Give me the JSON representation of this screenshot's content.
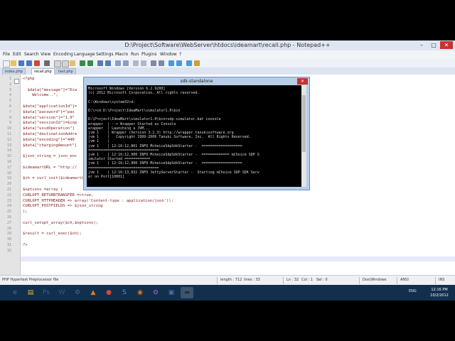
{
  "window": {
    "title": "D:\\Project\\Software\\WebServer\\htdocs\\ideamart\\recall.php - Notepad++",
    "controls": [
      "–",
      "□",
      "✕"
    ]
  },
  "menu": [
    "File",
    "Edit",
    "Search",
    "View",
    "Encoding",
    "Language",
    "Settings",
    "Macro",
    "Run",
    "Plugins",
    "Window",
    "?"
  ],
  "tabs": [
    "index.php",
    "recall.php",
    "test.php"
  ],
  "editor": {
    "line_numbers": [
      "1",
      "2",
      "3",
      "4",
      "5",
      "6",
      "7",
      "8",
      "9",
      "10",
      "11",
      "12",
      "13",
      "14",
      "15",
      "16",
      "17",
      "18",
      "19",
      "20",
      "21",
      "22",
      "23",
      "24",
      "25",
      "26",
      "27",
      "28",
      "29",
      "30",
      "31",
      "32"
    ],
    "lines": [
      "<?php",
      "",
      "  $data[\"message\"]=\"Dia",
      "    Welcome..\";",
      "",
      "$data[\"applicationId\"]=",
      "$data[\"password\"]=\"pas",
      "$data[\"version\"]=\"1.0\"",
      "$data[\"sessionId\"]=$inp",
      "$data[\"ussdOperation\"]",
      "$data[\"destinationAddre",
      "$data[\"encoding\"]=\"440",
      "$data[\"chargingAmount\"]",
      "",
      "$json_string = json_enc",
      "",
      "$ideamartURL = \"http://",
      "",
      "$ch = curl_init($ideamartURL);",
      "",
      "$options =array (",
      "CURLOPT_RETURNTRANSFER =>true,",
      "CURLOPT_HTTPHEADER => array('Content-type : application/json'));",
      "CURLOPT_POSTFIELDS => $json_string",
      ");",
      "",
      "curl_setopt_array($ch,$options);",
      "",
      "$result = curl_exec($ch);",
      "",
      "?>",
      ""
    ]
  },
  "status": {
    "filetype": "PHP Hypertext Preprocessor file",
    "length": "length : 712",
    "lines": "lines : 33",
    "position": "Ln : 32",
    "col": "Col : 1",
    "sel": "Sel : 0",
    "eol": "Dos\\Windows",
    "encoding": "ANSI",
    "mode": "INS"
  },
  "console": {
    "title": "sdk-standalone",
    "close": "✕",
    "lines": [
      "Microsoft Windows [Version 6.2.9200]",
      "(c) 2012 Microsoft Corporation. All rights reserved.",
      "",
      "C:\\Windows\\system32>d:",
      "",
      "D:\\>cd D:\\Project\\IdeaMart\\simulator1.0\\bin",
      "",
      "D:\\Project\\IdeaMart\\simulator1.0\\bin>sdp-simulator.bat console",
      "wrapper  | --> Wrapper Started as Console",
      "wrapper  | Launching a JVM...",
      "jvm 1    | Wrapper (Version 3.2.3) http://wrapper.tanukisoftware.org",
      "jvm 1    |   Copyright 1999-2006 Tanuki Software, Inc.  All Rights Reserved.",
      "jvm 1    |",
      "jvm 1    | 12:16:12,861 INFO McheiceSdpSdkStarter -  ===================",
      "=================================",
      "jvm 1    | 12:16:12,900 INFO McheiceSdpSdkStarter -  ============= mChoice SDP S",
      "imulator Started ============",
      "jvm 1    | 12:16:12,900 INFO McheiceSdpSdkStarter -  ===================",
      "=================================",
      "jvm 1    | 12:16:13,832 INFO JettyServerStarter -  Starting mChoice SDP SDK Serv",
      "er on Port[10001]"
    ]
  },
  "taskbar": {
    "icons": [
      {
        "name": "ie-icon",
        "glyph": "e",
        "color": "#2a7fd4"
      },
      {
        "name": "explorer-icon",
        "glyph": "▤",
        "color": "#e6b63a"
      },
      {
        "name": "ps-icon",
        "glyph": "Ps",
        "color": "#2b5c9a"
      },
      {
        "name": "word-icon",
        "glyph": "W",
        "color": "#2a5699"
      },
      {
        "name": "network-icon",
        "glyph": "⚙",
        "color": "#2f6ea8"
      },
      {
        "name": "vlc-icon",
        "glyph": "▲",
        "color": "#e87a1c"
      },
      {
        "name": "chrome-icon",
        "glyph": "●",
        "color": "#d94836"
      },
      {
        "name": "skype-icon",
        "glyph": "S",
        "color": "#2aa6e0"
      },
      {
        "name": "firefox-icon",
        "glyph": "◉",
        "color": "#e6701c"
      },
      {
        "name": "settings-icon",
        "glyph": "✿",
        "color": "#8c5ab8"
      },
      {
        "name": "media-icon",
        "glyph": "▣",
        "color": "#4a6ea8"
      },
      {
        "name": "cmd-icon",
        "glyph": "▬",
        "color": "#303030"
      }
    ],
    "lang": "ENG",
    "time": "12:16 PM",
    "date": "10/2/2012"
  }
}
